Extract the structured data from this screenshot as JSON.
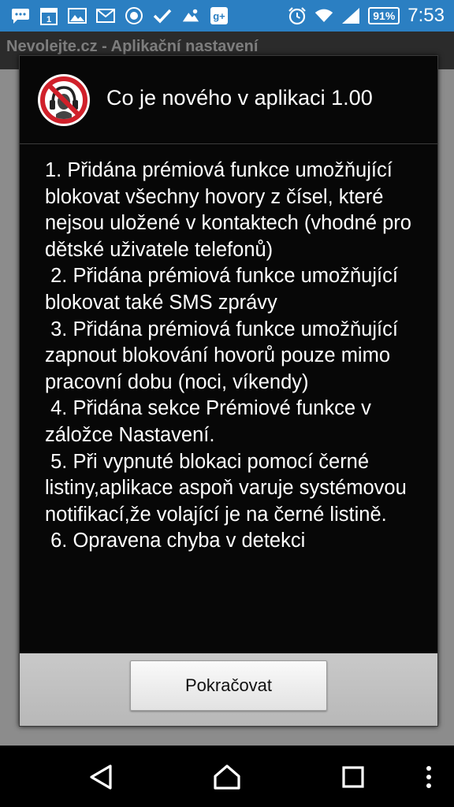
{
  "status_bar": {
    "left_icons": [
      "messaging-icon",
      "calendar-icon",
      "gallery-icon",
      "gmail-icon",
      "app-icon",
      "check-icon",
      "weather-icon",
      "google-plus-icon"
    ],
    "calendar_day": "1",
    "alarm_icon": "alarm-icon",
    "wifi_icon": "wifi-icon",
    "signal_icon": "signal-icon",
    "battery": "91%",
    "time": "7:53",
    "background_color": "#2b7fc2"
  },
  "background_app": {
    "title": "Nevolejte.cz - Aplikační nastavení"
  },
  "dialog": {
    "logo_icon": "no-calls-icon",
    "title": "Co je nového v aplikaci 1.00",
    "changelog": "1. Přidána prémiová funkce umožňující blokovat všechny hovory z čísel, které nejsou uložené v kontaktech (vhodné pro dětské uživatele telefonů)\n 2. Přidána prémiová funkce umožňující blokovat také SMS zprávy\n 3. Přidána prémiová funkce umožňující zapnout blokování hovorů pouze mimo pracovní dobu (noci, víkendy)\n 4. Přidána sekce Prémiové funkce v záložce Nastavení.\n 5. Při vypnuté blokaci pomocí černé listiny,aplikace aspoň varuje systémovou notifikací,že volající je na černé listině.\n 6. Opravena chyba v detekci",
    "continue_label": "Pokračovat"
  },
  "nav_bar": {
    "back_icon": "back-icon",
    "home_icon": "home-icon",
    "recents_icon": "recents-icon",
    "menu_icon": "overflow-menu-icon"
  },
  "colors": {
    "accent": "#2b7fc2",
    "logo_red": "#d0202a",
    "dialog_bg": "#070707"
  }
}
